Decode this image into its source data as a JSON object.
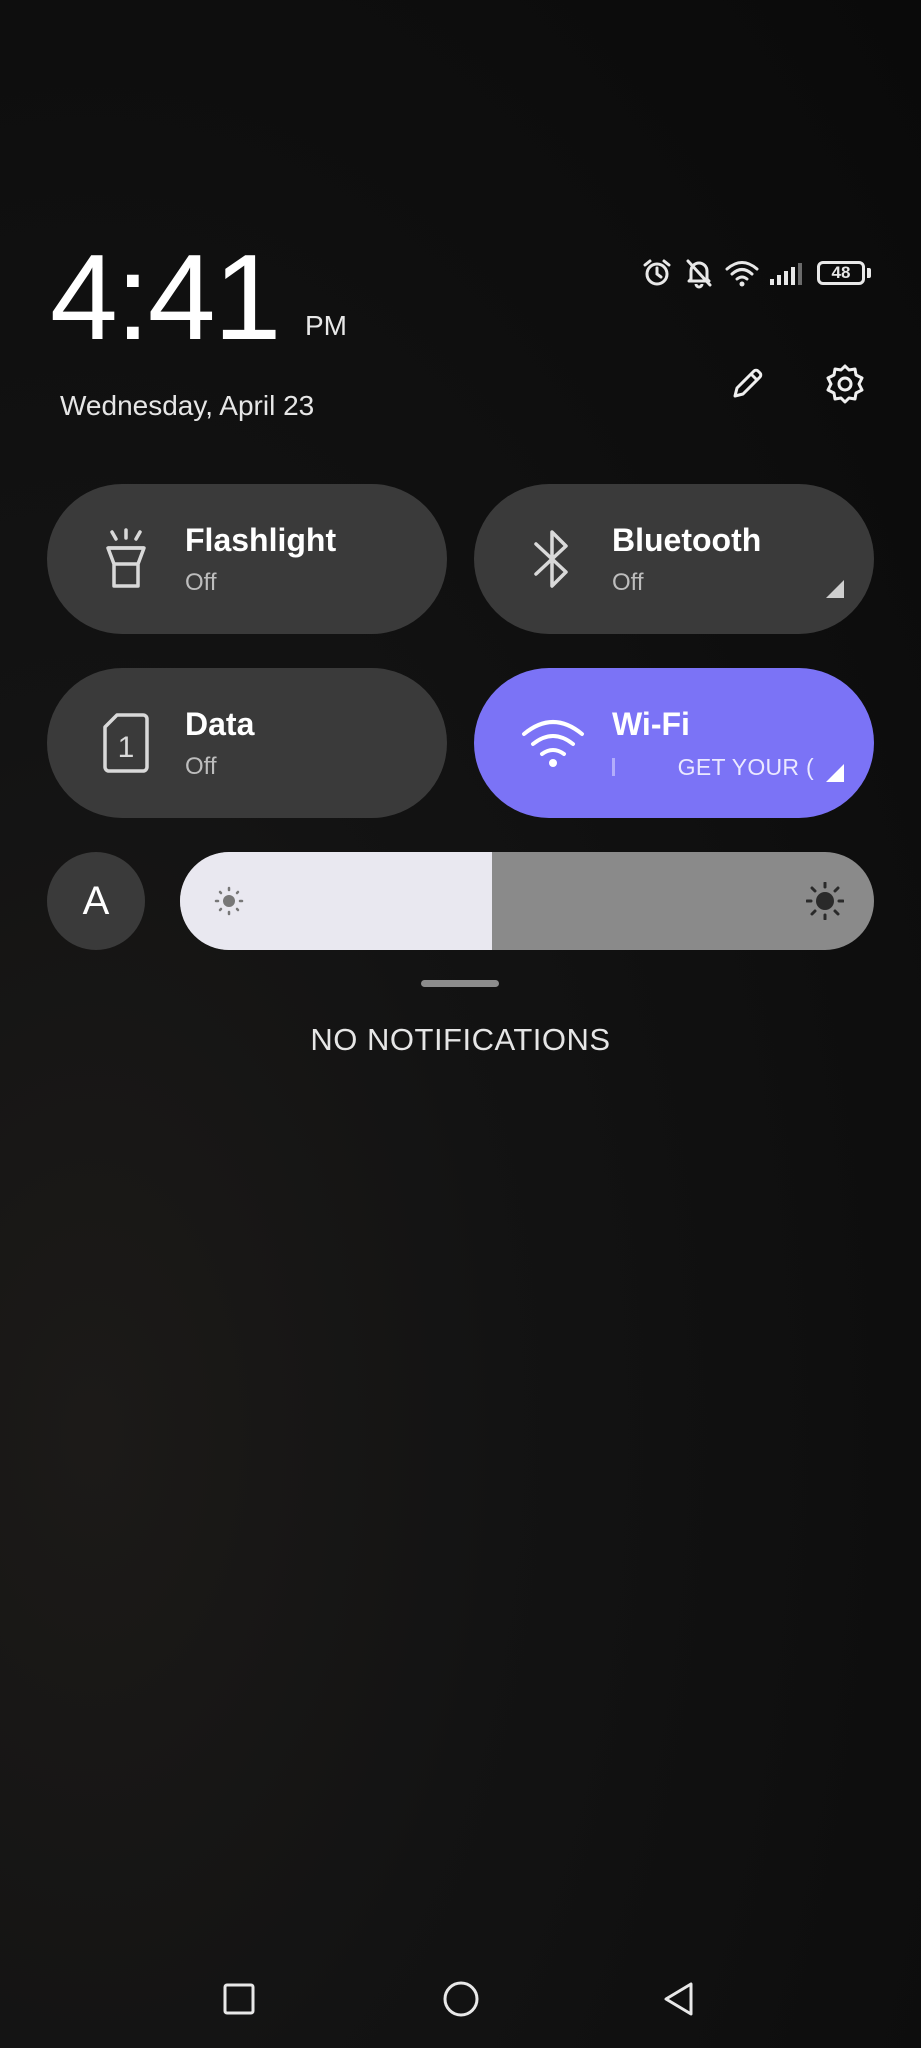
{
  "clock": {
    "time": "4:41",
    "ampm": "PM",
    "date": "Wednesday, April 23"
  },
  "status_bar": {
    "icons": [
      "alarm-icon",
      "bell-muted-icon",
      "wifi-icon",
      "cellular-signal-icon",
      "battery-icon"
    ],
    "battery_level": "48"
  },
  "header_actions": {
    "edit_icon": "pencil-icon",
    "settings_icon": "gear-icon"
  },
  "tiles": [
    {
      "title": "Flashlight",
      "status": "Off",
      "icon": "flashlight-icon",
      "active": false
    },
    {
      "title": "Bluetooth",
      "status": "Off",
      "icon": "bluetooth-icon",
      "active": false
    },
    {
      "title": "Data",
      "status": "Off",
      "icon": "sim-card-icon",
      "active": false
    },
    {
      "title": "Wi-Fi",
      "status": "GET YOUR (",
      "icon": "wifi-icon",
      "active": true
    }
  ],
  "brightness": {
    "auto_label": "A",
    "level": 0.45
  },
  "notifications": {
    "empty_text": "NO NOTIFICATIONS"
  },
  "nav": {
    "buttons": [
      "recents-square-icon",
      "home-circle-icon",
      "back-triangle-icon"
    ]
  },
  "colors": {
    "tile_bg": "#3a3a3a",
    "tile_active": "#7b73f6",
    "slider_fill": "#e9e8f0",
    "slider_track": "#8a8a8a"
  }
}
